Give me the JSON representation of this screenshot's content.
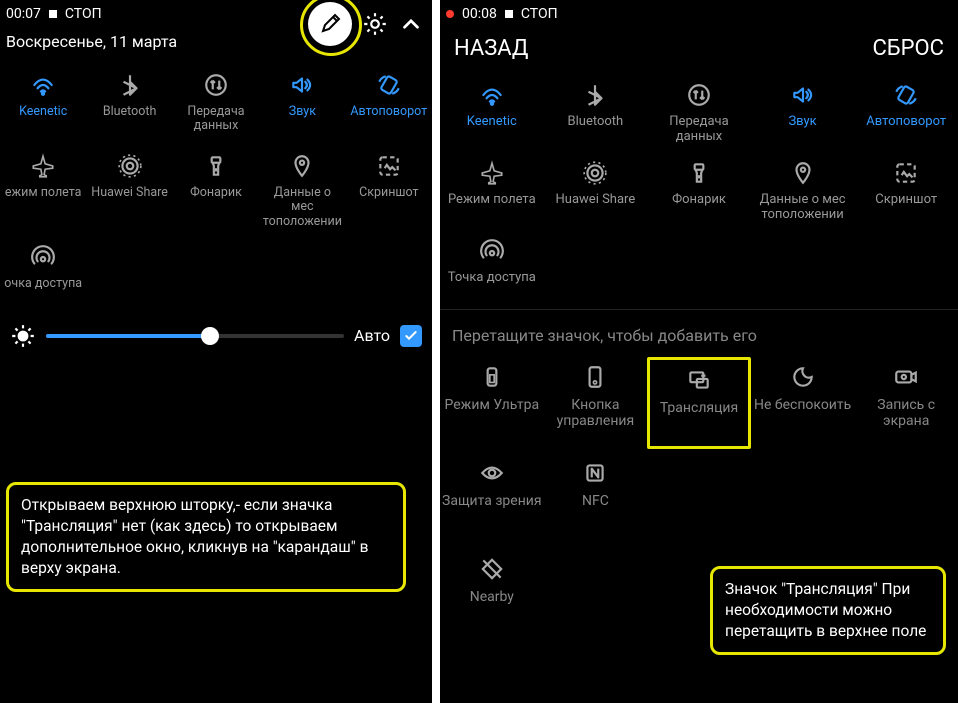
{
  "left": {
    "status": {
      "time": "00:07",
      "stop_label": "СТОП"
    },
    "date_text": "Воскресенье, 11 марта",
    "tiles_row1": [
      {
        "label": "Keenetic",
        "active": true,
        "icon": "wifi"
      },
      {
        "label": "Bluetooth",
        "active": false,
        "icon": "bluetooth"
      },
      {
        "label": "Передача данных",
        "active": false,
        "icon": "data"
      },
      {
        "label": "Звук",
        "active": true,
        "icon": "sound"
      },
      {
        "label": "Автоповорот",
        "active": true,
        "icon": "rotate"
      }
    ],
    "tiles_row2": [
      {
        "label": "ежим полета",
        "active": false,
        "icon": "airplane"
      },
      {
        "label": "Huawei Share",
        "active": false,
        "icon": "share"
      },
      {
        "label": "Фонарик",
        "active": false,
        "icon": "torch"
      },
      {
        "label": "Данные о мес тоположении",
        "active": false,
        "icon": "location"
      },
      {
        "label": "Скриншот",
        "active": false,
        "icon": "screenshot"
      }
    ],
    "tiles_row3": [
      {
        "label": "очка доступа",
        "active": false,
        "icon": "hotspot"
      }
    ],
    "brightness": {
      "auto_label": "Авто",
      "checked": true,
      "value_pct": 55
    },
    "callout": "Открываем верхнюю шторку,- если значка \"Трансляция\" нет (как здесь) то открываем дополнительное окно, кликнув на \"карандаш\" в верху экрана."
  },
  "right": {
    "status": {
      "time": "00:08",
      "stop_label": "СТОП",
      "recording": true
    },
    "nav": {
      "back": "НАЗАД",
      "reset": "СБРОС"
    },
    "tiles_row1": [
      {
        "label": "Keenetic",
        "active": true,
        "icon": "wifi"
      },
      {
        "label": "Bluetooth",
        "active": false,
        "icon": "bluetooth"
      },
      {
        "label": "Передача данных",
        "active": false,
        "icon": "data"
      },
      {
        "label": "Звук",
        "active": true,
        "icon": "sound"
      },
      {
        "label": "Автоповорот",
        "active": true,
        "icon": "rotate"
      }
    ],
    "tiles_row2": [
      {
        "label": "Режим полета",
        "active": false,
        "icon": "airplane"
      },
      {
        "label": "Huawei Share",
        "active": false,
        "icon": "share"
      },
      {
        "label": "Фонарик",
        "active": false,
        "icon": "torch"
      },
      {
        "label": "Данные о мес тоположении",
        "active": false,
        "icon": "location"
      },
      {
        "label": "Скриншот",
        "active": false,
        "icon": "screenshot"
      }
    ],
    "tiles_row3": [
      {
        "label": "Точка доступа",
        "active": false,
        "icon": "hotspot"
      }
    ],
    "instruction": "Перетащите значок, чтобы добавить его",
    "avail_row1": [
      {
        "label": "Режим Ультра",
        "icon": "ultra"
      },
      {
        "label": "Кнопка управления",
        "icon": "navbtn"
      },
      {
        "label": "Трансляция",
        "icon": "cast",
        "highlight": true
      },
      {
        "label": "Не беспокоить",
        "icon": "dnd"
      },
      {
        "label": "Запись с экрана",
        "icon": "record"
      }
    ],
    "avail_row2": [
      {
        "label": "Защита зрения",
        "icon": "eye"
      },
      {
        "label": "NFC",
        "icon": "nfc"
      }
    ],
    "avail_row3": [
      {
        "label": "Nearby",
        "icon": "nearby"
      }
    ],
    "callout": "Значок \"Трансляция\" При необходимости можно перетащить в верхнее поле"
  }
}
